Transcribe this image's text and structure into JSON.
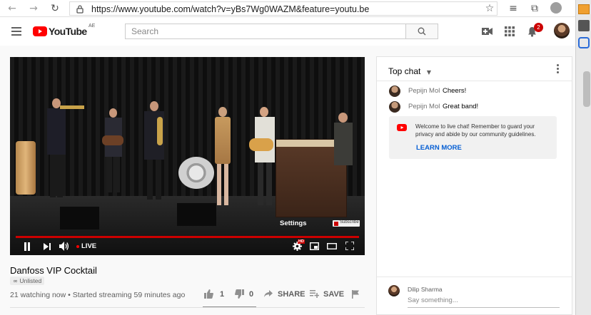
{
  "browser": {
    "url": "https://www.youtube.com/watch?v=yBs7Wg0WAZM&feature=youtu.be"
  },
  "header": {
    "logo_text": "YouTube",
    "region": "AE",
    "search_placeholder": "Search",
    "notification_count": "2"
  },
  "player": {
    "live_label": "LIVE",
    "settings_tooltip": "Settings",
    "subscribe_label": "Subscribe",
    "hd_badge": "HD",
    "progress": 1.0
  },
  "video": {
    "title": "Danfoss VIP Cocktail",
    "unlisted_label": "Unlisted",
    "stats": "21 watching now • Started streaming 59 minutes ago",
    "likes": "1",
    "dislikes": "0",
    "share_label": "SHARE",
    "save_label": "SAVE"
  },
  "chat": {
    "header_label": "Top chat",
    "messages": [
      {
        "author": "Pepijn Mol",
        "text": "Cheers!"
      },
      {
        "author": "Pepijn Mol",
        "text": "Great band!"
      }
    ],
    "welcome_text": "Welcome to live chat! Remember to guard your privacy and abide by our community guidelines.",
    "learn_more_label": "LEARN MORE",
    "current_user": "Dilip Sharma",
    "input_placeholder": "Say something..."
  },
  "colors": {
    "youtube_red": "#ff0000",
    "link_blue": "#065fd4",
    "progress_red": "#cc0000"
  }
}
